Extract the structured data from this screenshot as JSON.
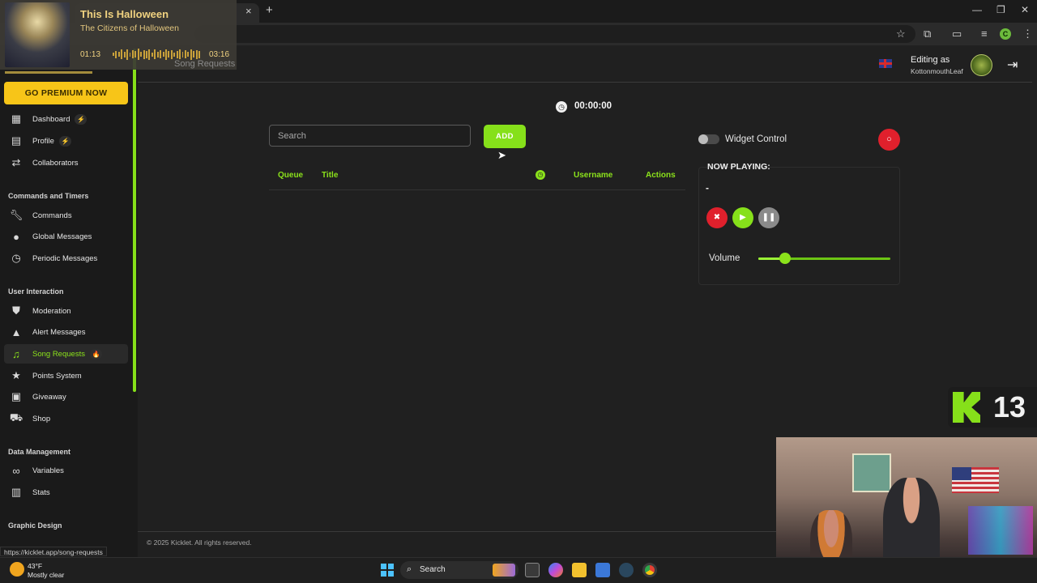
{
  "media": {
    "title": "This Is Halloween",
    "artist": "The Citizens of Halloween",
    "current_time": "01:13",
    "duration": "03:16",
    "progress": 0.37
  },
  "browser": {
    "new_tab": "+",
    "tab_close": "×"
  },
  "sidebar": {
    "premium_label": "GO PREMIUM NOW",
    "items_main": [
      {
        "label": "Dashboard",
        "icon": "dashboard-icon",
        "badge": "⚡"
      },
      {
        "label": "Profile",
        "icon": "profile-icon",
        "badge": "⚡"
      },
      {
        "label": "Collaborators",
        "icon": "collaborators-icon"
      }
    ],
    "section_commands": "Commands and Timers",
    "items_commands": [
      {
        "label": "Commands",
        "icon": "wrench-icon"
      },
      {
        "label": "Global Messages",
        "icon": "chat-bubble-icon"
      },
      {
        "label": "Periodic Messages",
        "icon": "clock-icon"
      }
    ],
    "section_user": "User Interaction",
    "items_user": [
      {
        "label": "Moderation",
        "icon": "shield-icon"
      },
      {
        "label": "Alert Messages",
        "icon": "warning-icon"
      },
      {
        "label": "Song Requests",
        "icon": "music-note-icon",
        "badge": "🔥",
        "active": true
      },
      {
        "label": "Points System",
        "icon": "star-icon"
      },
      {
        "label": "Giveaway",
        "icon": "gift-icon"
      },
      {
        "label": "Shop",
        "icon": "cart-icon"
      }
    ],
    "section_data": "Data Management",
    "items_data": [
      {
        "label": "Variables",
        "icon": "link-icon"
      },
      {
        "label": "Stats",
        "icon": "bar-chart-icon"
      }
    ],
    "section_graphic": "Graphic Design",
    "status_url": "https://kicklet.app/song-requests"
  },
  "header": {
    "breadcrumb": "Song Requests",
    "editing_as": "Editing as",
    "username": "KottonmouthLeaf"
  },
  "main": {
    "timer": "00:00:00",
    "search_placeholder": "Search",
    "add_label": "ADD",
    "columns": {
      "queue": "Queue",
      "title": "Title",
      "username": "Username",
      "actions": "Actions"
    }
  },
  "widget": {
    "control_label": "Widget Control",
    "toggle_on": false,
    "now_playing_label": "NOW PLAYING:",
    "now_playing_song": "-",
    "volume_label": "Volume",
    "volume": 0.2
  },
  "footer": {
    "copyright": "© 2025 Kicklet. All rights reserved."
  },
  "overlay": {
    "kick_number": "13"
  },
  "taskbar": {
    "temperature": "43°F",
    "weather": "Mostly clear",
    "search_label": "Search"
  },
  "colors": {
    "accent": "#86e01a",
    "premium": "#f7c518",
    "record": "#e0202c",
    "background": "#202020",
    "sidebar": "#1a1a1a"
  }
}
